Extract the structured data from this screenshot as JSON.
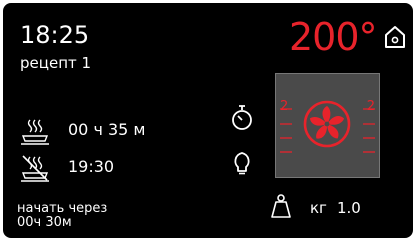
{
  "clock": "18:25",
  "recipe": "рецепт 1",
  "temperature": "200°",
  "cook_time": "00 ч 35 м",
  "end_time": "19:30",
  "start_delay_label": "начать через",
  "start_delay_value": "00ч 30м",
  "rack_level_left": "2",
  "rack_level_right": "2",
  "weight_unit": "кг",
  "weight_value": "1.0",
  "colors": {
    "accent": "#e8232b",
    "background": "#000000",
    "text": "#ffffff",
    "panel": "#4a4a4a"
  },
  "icons": {
    "home": "home-icon",
    "cook_duration": "steam-dish-icon",
    "end_time": "crossed-dish-icon",
    "timer": "stopwatch-icon",
    "light": "bulb-icon",
    "fan": "convection-fan-icon",
    "weight": "weight-icon"
  }
}
